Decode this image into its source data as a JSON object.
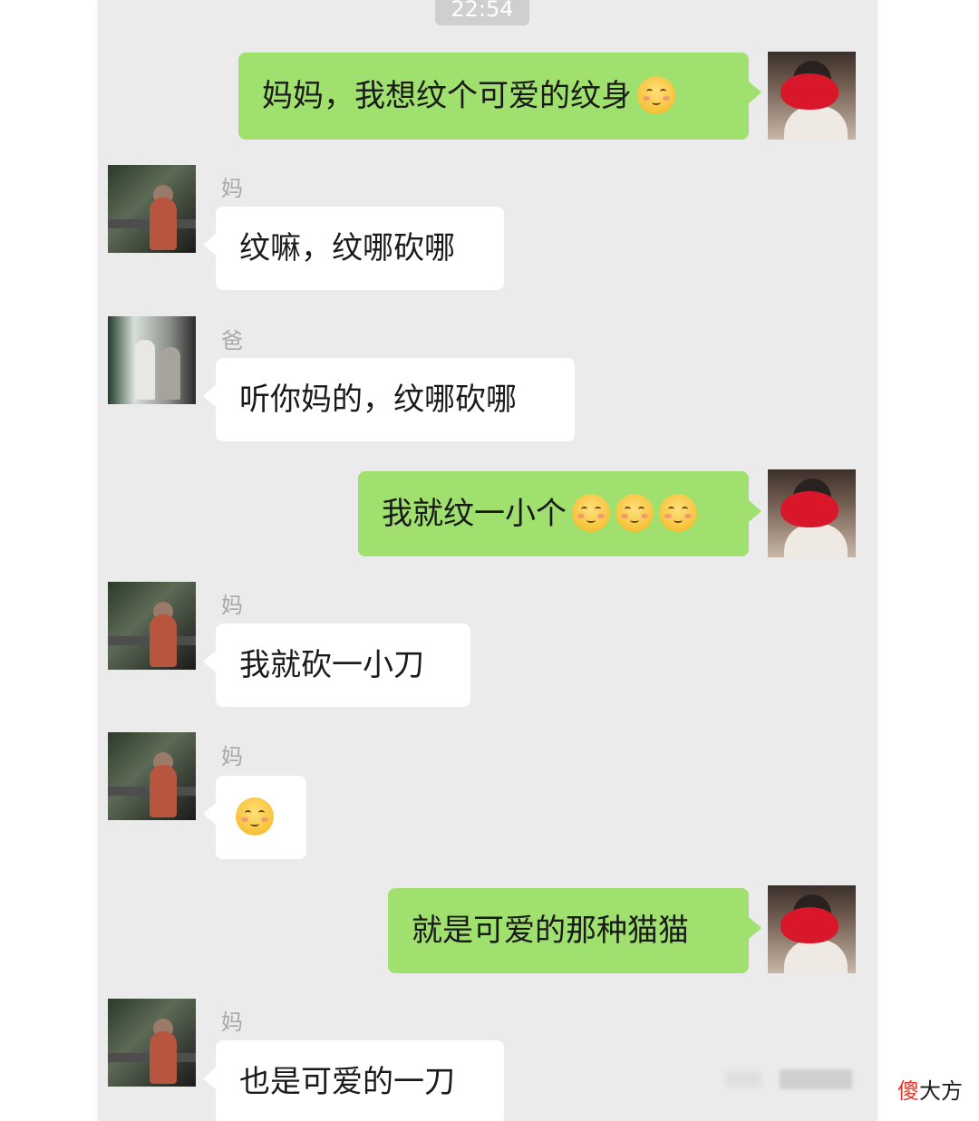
{
  "timestamp": "22:54",
  "colors": {
    "panel_background": "#ebebeb",
    "outgoing_bubble": "#9fe06e",
    "incoming_bubble": "#ffffff",
    "sender_name": "#a8a8a8",
    "watermark_accent": "#e23a2a"
  },
  "messages": [
    {
      "direction": "outgoing",
      "text": "妈妈，我想纹个可爱的纹身",
      "emoji_count": 1,
      "avatar": "self-avatar"
    },
    {
      "direction": "incoming",
      "sender": "妈妈",
      "text": "纹嘛，纹哪砍哪",
      "avatar": "mom-avatar"
    },
    {
      "direction": "incoming",
      "sender": "爸爸",
      "text": "听你妈的，纹哪砍哪",
      "avatar": "dad-avatar"
    },
    {
      "direction": "outgoing",
      "text": "我就纹一小个",
      "emoji_count": 3,
      "avatar": "self-avatar"
    },
    {
      "direction": "incoming",
      "sender": "妈妈",
      "text": "我就砍一小刀",
      "avatar": "mom-avatar"
    },
    {
      "direction": "incoming",
      "sender": "妈妈",
      "text": "",
      "emoji_count": 1,
      "avatar": "mom-avatar"
    },
    {
      "direction": "outgoing",
      "text": "就是可爱的那种猫猫",
      "avatar": "self-avatar"
    },
    {
      "direction": "incoming",
      "sender": "妈妈",
      "text": "也是可爱的一刀",
      "avatar": "mom-avatar"
    }
  ],
  "watermark": {
    "accent_char": "傻",
    "rest": "大方"
  }
}
